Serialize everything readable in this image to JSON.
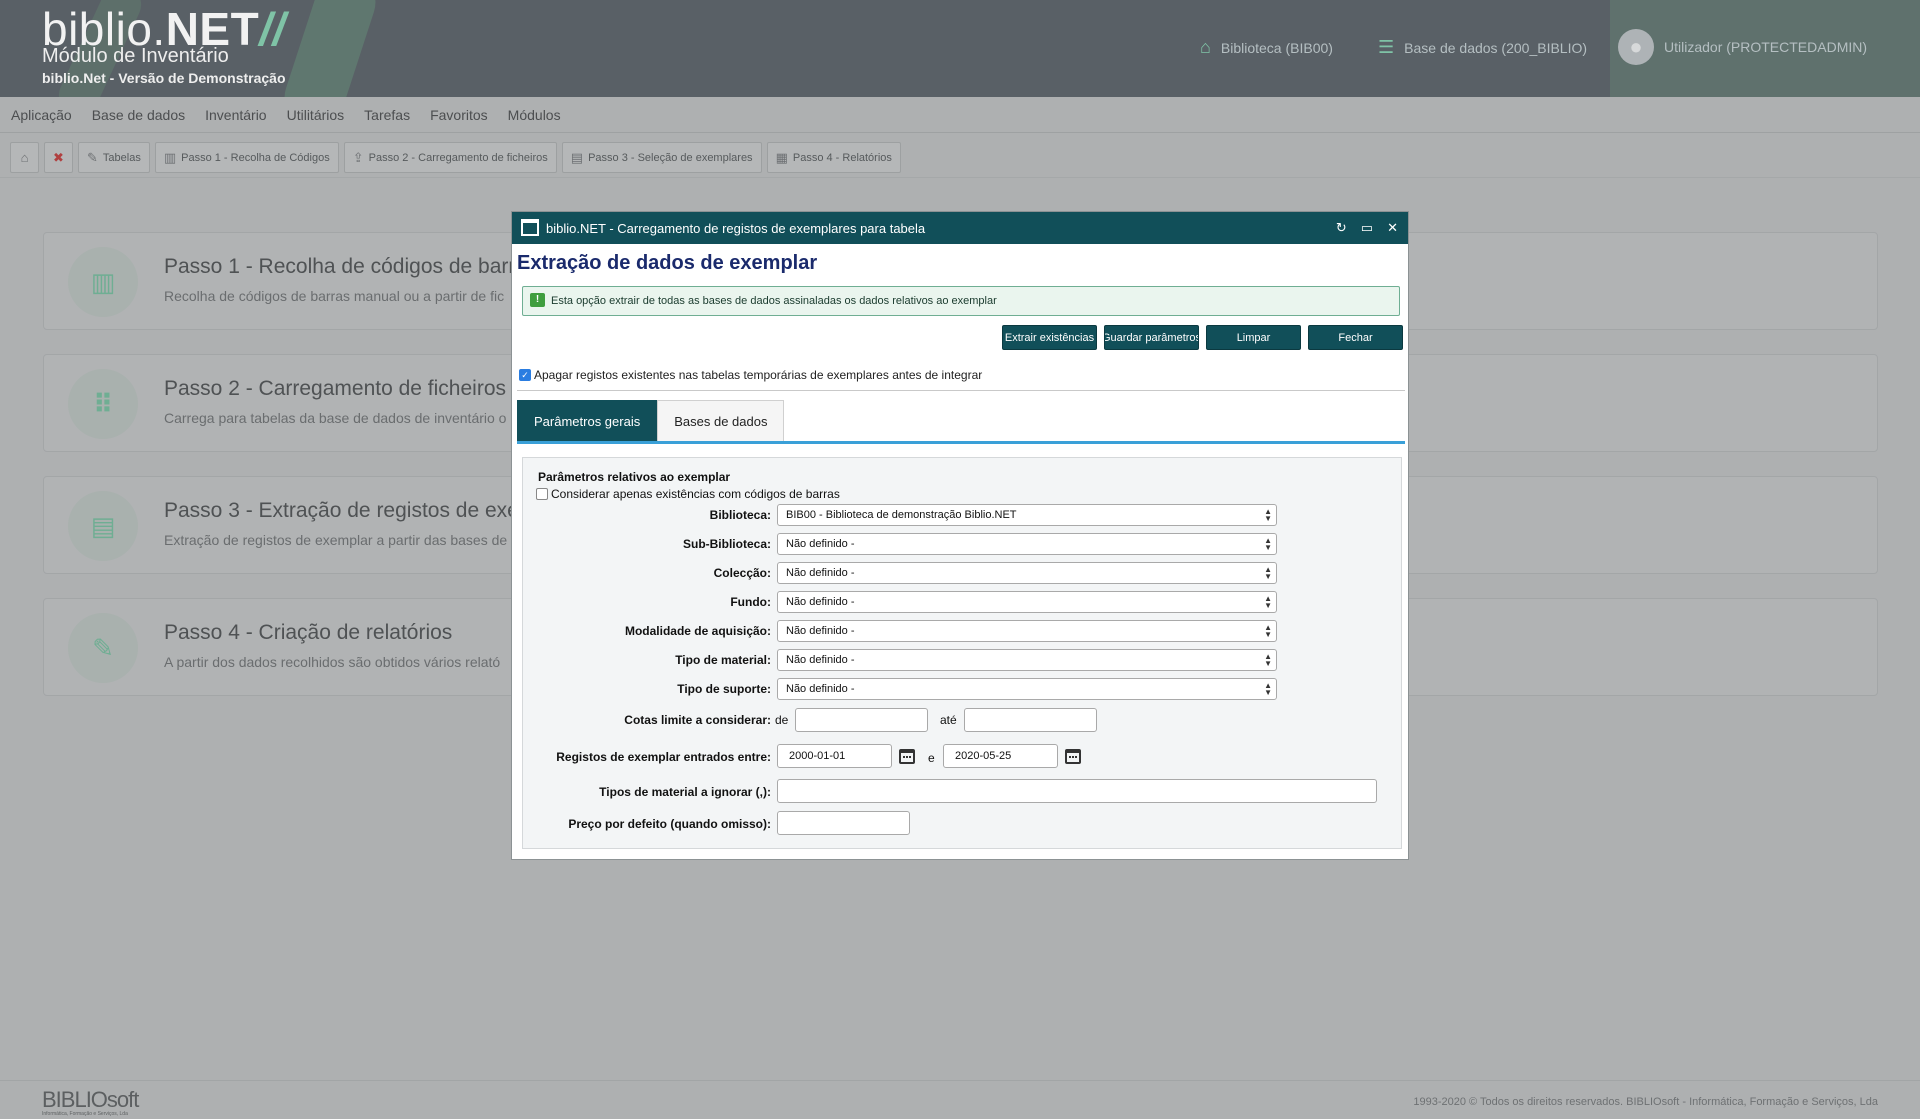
{
  "header": {
    "logo_text": "biblio.",
    "logo_bold": "NET",
    "logo_slash": "//",
    "module_title": "Módulo de Inventário",
    "module_subtitle": "biblio.Net - Versão de Demonstração",
    "library": "Biblioteca (BIB00)",
    "database": "Base de dados (200_BIBLIO)",
    "user": "Utilizador (PROTECTEDADMIN)"
  },
  "menu": [
    "Aplicação",
    "Base de dados",
    "Inventário",
    "Utilitários",
    "Tarefas",
    "Favoritos",
    "Módulos"
  ],
  "toolbar": {
    "tables": "Tabelas",
    "step1": "Passo 1 - Recolha de Códigos",
    "step2": "Passo 2 - Carregamento de ficheiros",
    "step3": "Passo 3 - Seleção de exemplares",
    "step4": "Passo 4 - Relatórios"
  },
  "cards": [
    {
      "title": "Passo 1 - Recolha de códigos de barr",
      "desc": "Recolha de códigos de barras manual ou a partir de fic"
    },
    {
      "title": "Passo 2 - Carregamento de ficheiros",
      "desc": "Carrega para tabelas da base de dados de inventário o"
    },
    {
      "title": "Passo 3 - Extração de registos de exe",
      "desc": "Extração de registos de exemplar a partir das bases de"
    },
    {
      "title": "Passo 4 - Criação de relatórios",
      "desc": "A partir dos dados recolhidos são obtidos vários relató"
    }
  ],
  "footer": {
    "logo": "BIBLIOsoft",
    "logo_small": "Informática, Formação e Serviços, Lda",
    "copyright": "1993-2020 © Todos os direitos reservados. BIBLIOsoft - Informática, Formação e Serviços, Lda"
  },
  "modal": {
    "window_title": "biblio.NET - Carregamento de registos de exemplares para tabela",
    "heading": "Extração de dados de exemplar",
    "info": "Esta opção extrair de todas as bases de dados assinaladas os dados relativos ao exemplar",
    "buttons": {
      "extract": "Extrair existências",
      "save": "Guardar parâmetros",
      "clear": "Limpar",
      "close": "Fechar"
    },
    "delete_existing_label": "Apagar registos existentes nas tabelas temporárias de exemplares antes de integrar",
    "delete_existing_checked": true,
    "tabs": {
      "general": "Parâmetros gerais",
      "databases": "Bases de dados"
    },
    "fieldset_legend": "Parâmetros relativos ao exemplar",
    "barcode_only_label": "Considerar apenas existências com códigos de barras",
    "barcode_only_checked": false,
    "fields": {
      "biblioteca": {
        "label": "Biblioteca:",
        "value": "BIB00 - Biblioteca de demonstração Biblio.NET"
      },
      "sub_biblioteca": {
        "label": "Sub-Biblioteca:",
        "value": "Não definido -"
      },
      "coleccao": {
        "label": "Colecção:",
        "value": "Não definido -"
      },
      "fundo": {
        "label": "Fundo:",
        "value": "Não definido -"
      },
      "modalidade": {
        "label": "Modalidade de aquisição:",
        "value": "Não definido -"
      },
      "tipo_material": {
        "label": "Tipo de material:",
        "value": "Não definido -"
      },
      "tipo_suporte": {
        "label": "Tipo de suporte:",
        "value": "Não definido -"
      }
    },
    "cotas": {
      "label": "Cotas limite a considerar:",
      "from_word": "de",
      "to_word": "até",
      "from_value": "",
      "to_value": ""
    },
    "dates": {
      "label": "Registos de exemplar entrados entre:",
      "start": "2000-01-01",
      "and_word": "e",
      "end": "2020-05-25"
    },
    "ignore_types": {
      "label": "Tipos de material a ignorar (,):",
      "value": ""
    },
    "default_price": {
      "label": "Preço por defeito (quando omisso):",
      "value": ""
    }
  }
}
